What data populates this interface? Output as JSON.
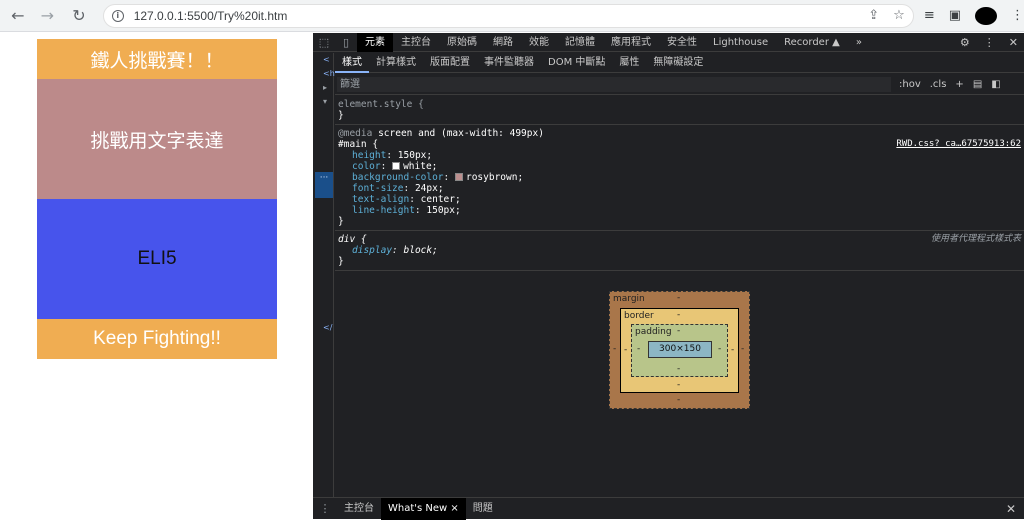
{
  "browser": {
    "url": "127.0.0.1:5500/Try%20it.htm"
  },
  "page": {
    "blocks": [
      {
        "text": "鐵人挑戰賽！！"
      },
      {
        "text": "挑戰用文字表達"
      },
      {
        "text": "ELI5"
      },
      {
        "text": "Keep Fighting!!"
      }
    ]
  },
  "devtools": {
    "main_tabs": [
      "元素",
      "主控台",
      "原始碼",
      "網路",
      "效能",
      "記憶體",
      "應用程式",
      "安全性",
      "Lighthouse",
      "Recorder ▲",
      "»"
    ],
    "sub_tabs": [
      "樣式",
      "計算樣式",
      "版面配置",
      "事件監聽器",
      "DOM 中斷點",
      "屬性",
      "無障礙設定"
    ],
    "filter_placeholder": "篩選",
    "filter_tools": [
      ":hov",
      ".cls",
      "+"
    ],
    "rules": {
      "element_style": {
        "selector": "element.style {",
        "close": "}"
      },
      "main": {
        "media": "@media",
        "media_query": "screen and (max-width: 499px)",
        "selector": "#main {",
        "source": "RWD.css?_ca…67575913:62",
        "props": [
          {
            "name": "height",
            "value": "150px;"
          },
          {
            "name": "color",
            "value": "white;"
          },
          {
            "name": "background-color",
            "value": "rosybrown;"
          },
          {
            "name": "font-size",
            "value": "24px;"
          },
          {
            "name": "text-align",
            "value": "center;"
          },
          {
            "name": "line-height",
            "value": "150px;"
          }
        ],
        "close": "}"
      },
      "div": {
        "selector": "div {",
        "source": "使用者代理程式樣式表",
        "prop_name": "display",
        "prop_value": "block;",
        "close": "}"
      }
    },
    "box_model": {
      "margin_label": "margin",
      "border_label": "border",
      "padding_label": "padding",
      "content": "300×150",
      "dash": "-"
    },
    "drawer_tabs": [
      "主控台",
      "What's New ×",
      "問題"
    ]
  }
}
